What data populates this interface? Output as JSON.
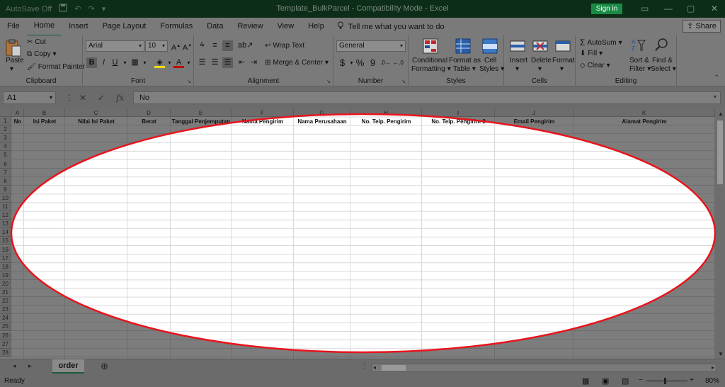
{
  "window": {
    "title": "Template_BulkParcel  -  Compatibility Mode  -  Excel",
    "autosave": "AutoSave",
    "autosave_state": "Off",
    "signin": "Sign in"
  },
  "ribbon": {
    "tabs": [
      "File",
      "Home",
      "Insert",
      "Page Layout",
      "Formulas",
      "Data",
      "Review",
      "View",
      "Help"
    ],
    "active_tab": "Home",
    "tellme": "Tell me what you want to do",
    "share": "Share",
    "clipboard": {
      "paste": "Paste",
      "cut": "Cut",
      "copy": "Copy",
      "format_painter": "Format Painter",
      "label": "Clipboard"
    },
    "font": {
      "name": "Arial",
      "size": "10",
      "bold": "B",
      "italic": "I",
      "underline": "U",
      "label": "Font"
    },
    "alignment": {
      "wrap": "Wrap Text",
      "merge": "Merge & Center",
      "label": "Alignment"
    },
    "number": {
      "format": "General",
      "currency": "$",
      "percent": "%",
      "comma": "9",
      "label": "Number"
    },
    "styles": {
      "conditional": "Conditional",
      "conditional2": "Formatting",
      "format_table": "Format as",
      "format_table2": "Table",
      "cell_styles": "Cell",
      "cell_styles2": "Styles",
      "label": "Styles"
    },
    "cells": {
      "insert": "Insert",
      "delete": "Delete",
      "format": "Format",
      "label": "Cells"
    },
    "editing": {
      "autosum": "AutoSum",
      "fill": "Fill",
      "clear": "Clear",
      "sort": "Sort &",
      "sort2": "Filter",
      "find": "Find &",
      "find2": "Select",
      "label": "Editing"
    }
  },
  "formula_bar": {
    "name_box": "A1",
    "fx": "fx",
    "content": "No"
  },
  "sheet": {
    "columns": [
      "A",
      "B",
      "C",
      "D",
      "E",
      "F",
      "G",
      "H",
      "I",
      "J",
      "K"
    ],
    "headers": [
      "No",
      "Isi Paket",
      "Nilai Isi Paket",
      "Berat",
      "Tanggal Penjemputan",
      "Nama Pengirim",
      "Nama Perusahaan",
      "No. Telp. Pengirim",
      "No. Telp. Pengirim 2",
      "Email Pengirim",
      "Alamat Pengirim"
    ],
    "rows": [
      "1",
      "2",
      "3",
      "4",
      "5",
      "6",
      "7",
      "8",
      "9",
      "10",
      "11",
      "12",
      "13",
      "14",
      "15",
      "16",
      "17",
      "18",
      "19",
      "20",
      "21",
      "22",
      "23",
      "24",
      "25",
      "26",
      "27",
      "28"
    ],
    "tab": "order"
  },
  "status": {
    "ready": "Ready",
    "zoom": "80%"
  },
  "colors": {
    "title_bar": "#0c2d17",
    "accent": "#185c37",
    "highlight": "#e8141c"
  }
}
